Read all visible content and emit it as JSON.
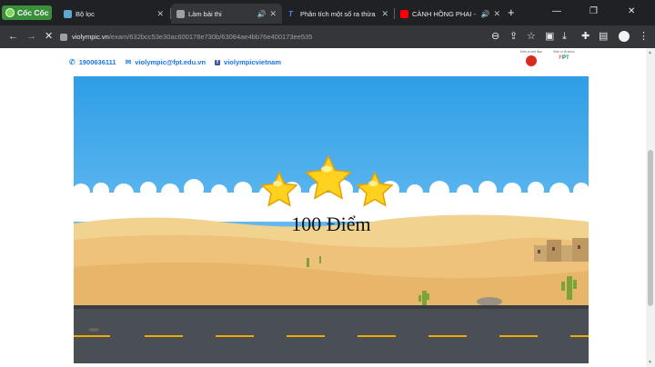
{
  "browser": {
    "brand": "Cốc Cốc",
    "tabs": [
      {
        "title": "Bộ lọc",
        "active": false
      },
      {
        "title": "Làm bài thi",
        "active": true
      },
      {
        "title": "Phân tích một số ra thừa số n",
        "active": false
      },
      {
        "title": "CÀNH HỒNG PHAI - NHẠC",
        "active": false
      }
    ],
    "url_host": "violympic.vn",
    "url_path": "/exam/632bcc53e30ac600178e730b/63084ae4bb76e400173ee535"
  },
  "header": {
    "phone": "1900636111",
    "email": "violympic@fpt.edu.vn",
    "facebook": "violympicvietnam",
    "sponsor1_label": "Đơn vị chủ đạo",
    "sponsor2_label": "Đơn vị tổ chức",
    "sponsor2_logo": "FPT"
  },
  "game": {
    "score_text": "100 Điểm",
    "stars_earned": 3,
    "stars_total": 3
  },
  "colors": {
    "sky": "#2e9ee6",
    "sand": "#f0c27a",
    "road": "#4a4f55",
    "star": "#ffd21f"
  }
}
